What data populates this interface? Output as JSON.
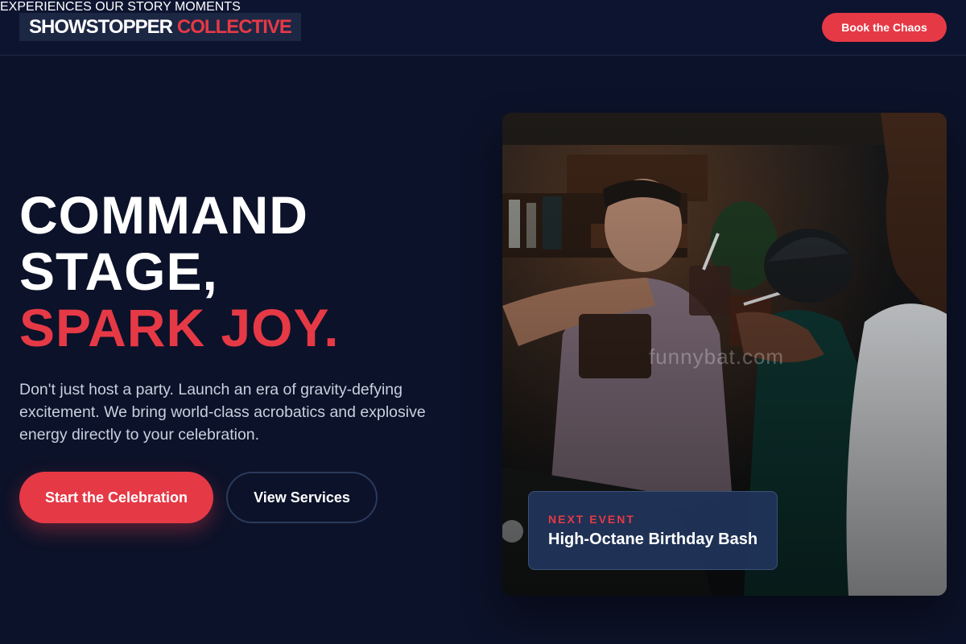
{
  "brand": {
    "name_part1": "SHOWSTOPPER",
    "name_part2": "COLLECTIVE"
  },
  "nav": {
    "items": [
      {
        "label": "EXPERIENCES"
      },
      {
        "label": "OUR STORY"
      },
      {
        "label": "MOMENTS"
      }
    ],
    "cta_label": "Book the Chaos"
  },
  "hero": {
    "headline_line1": "COMMAND",
    "headline_line2": "STAGE,",
    "headline_line3": "SPARK JOY.",
    "subtext": "Don't just host a party. Launch an era of gravity-defying excitement. We bring world-class acrobatics and explosive energy directly to your celebration.",
    "primary_button": "Start the Celebration",
    "secondary_button": "View Services"
  },
  "photo": {
    "watermark": "funnybat.com",
    "event_label": "NEXT EVENT",
    "event_title": "High-Octane Birthday Bash"
  },
  "colors": {
    "background": "#0c1229",
    "accent": "#e63946",
    "card": "#21345a"
  }
}
